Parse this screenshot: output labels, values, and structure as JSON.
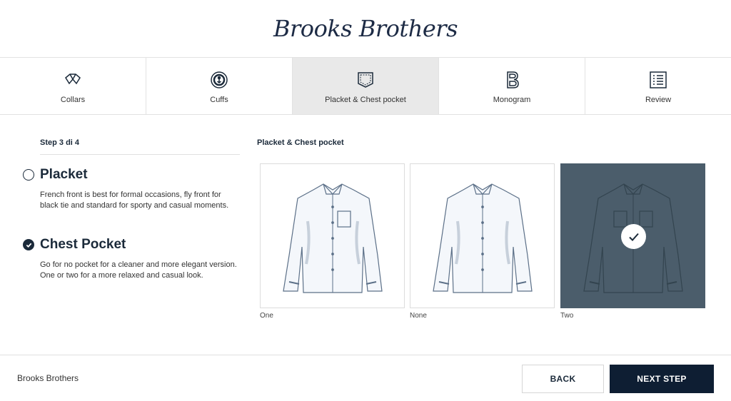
{
  "brand": {
    "logo_text": "Brooks Brothers",
    "footer_text": "Brooks Brothers"
  },
  "tabs": [
    {
      "label": "Collars",
      "icon": "collar-icon",
      "active": false
    },
    {
      "label": "Cuffs",
      "icon": "cufflink-icon",
      "active": false
    },
    {
      "label": "Placket & Chest pocket",
      "icon": "pocket-icon",
      "active": true
    },
    {
      "label": "Monogram",
      "icon": "monogram-b-icon",
      "active": false
    },
    {
      "label": "Review",
      "icon": "checklist-icon",
      "active": false
    }
  ],
  "step": {
    "text": "Step 3 di 4"
  },
  "options": {
    "placket": {
      "title": "Placket",
      "description": "French front is best for formal occasions, fly front for black tie and standard for sporty and casual moments.",
      "selected": false
    },
    "chest_pocket": {
      "title": "Chest Pocket",
      "description": "Go for no pocket for a cleaner and more elegant version. One or two for a more relaxed and casual look.",
      "selected": true
    }
  },
  "section": {
    "title": "Placket & Chest pocket"
  },
  "choices": [
    {
      "label": "One",
      "selected": false
    },
    {
      "label": "None",
      "selected": false
    },
    {
      "label": "Two",
      "selected": true
    }
  ],
  "footer": {
    "back_label": "BACK",
    "next_label": "NEXT STEP"
  },
  "colors": {
    "navy": "#0e1e33",
    "selected_card": "#4b5d6b",
    "active_tab": "#e9e9e9"
  }
}
